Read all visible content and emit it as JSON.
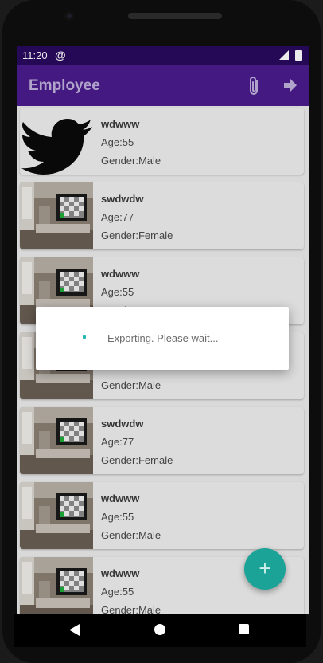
{
  "status_bar": {
    "time": "11:20",
    "at_icon": "@"
  },
  "app_bar": {
    "title": "Employee",
    "attach_icon": "paperclip-icon",
    "export_icon": "arrow-right-icon"
  },
  "employees": [
    {
      "name": "wdwww",
      "age": "Age:55",
      "gender": "Gender:Male",
      "image": "twitter-bird"
    },
    {
      "name": "swdwdw",
      "age": "Age:77",
      "gender": "Gender:Female",
      "image": "room-tv"
    },
    {
      "name": "wdwww",
      "age": "Age:55",
      "gender": "Gender:Male",
      "image": "room-tv"
    },
    {
      "name": "",
      "age": "",
      "gender": "Gender:Male",
      "image": "room-tv"
    },
    {
      "name": "swdwdw",
      "age": "Age:77",
      "gender": "Gender:Female",
      "image": "room-tv"
    },
    {
      "name": "wdwww",
      "age": "Age:55",
      "gender": "Gender:Male",
      "image": "room-tv"
    },
    {
      "name": "wdwww",
      "age": "Age:55",
      "gender": "Gender:Male",
      "image": "room-tv"
    }
  ],
  "dialog": {
    "message": "Exporting. Please wait..."
  },
  "fab": {
    "label": "+"
  },
  "colors": {
    "primary": "#4a1d8e",
    "status_bar": "#2a0a5e",
    "accent": "#1aa396"
  }
}
